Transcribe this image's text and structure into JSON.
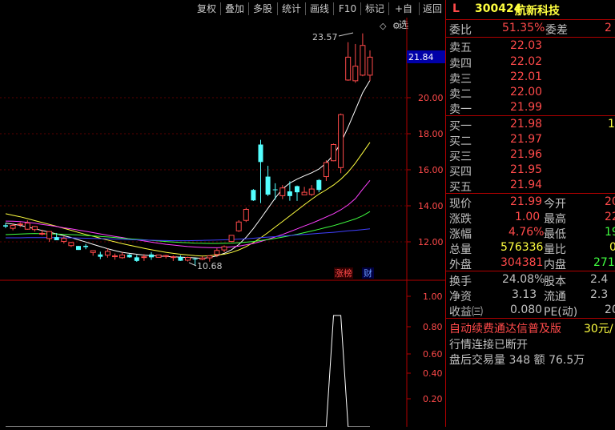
{
  "toolbar": {
    "buttons": [
      "复权",
      "叠加",
      "多股",
      "统计",
      "画线",
      "F10",
      "标记",
      "+自选",
      "返回"
    ]
  },
  "chart": {
    "price_ticks": [
      "20.00",
      "18.00",
      "16.00",
      "14.00",
      "12.00"
    ],
    "current_price_tag": "21.84",
    "high_annotation": "23.57",
    "low_annotation": "10.68",
    "badge_zhangbang": "涨榜",
    "badge_cai": "财",
    "indicator_ticks": [
      "1.00",
      "0.80",
      "0.60",
      "0.40",
      "0.20"
    ],
    "diamond_glyph": "◇"
  },
  "chart_data": {
    "type": "candlestick",
    "candles": [
      {
        "o": 12.92,
        "c": 12.85,
        "h": 13.05,
        "l": 12.76
      },
      {
        "o": 12.75,
        "c": 12.91,
        "h": 13.03,
        "l": 12.64
      },
      {
        "o": 12.99,
        "c": 12.99,
        "h": 13.08,
        "l": 12.82
      },
      {
        "o": 12.7,
        "c": 13.04,
        "h": 13.19,
        "l": 12.67
      },
      {
        "o": 12.68,
        "c": 12.85,
        "h": 12.88,
        "l": 12.57
      },
      {
        "o": 12.47,
        "c": 12.47,
        "h": 12.67,
        "l": 12.36
      },
      {
        "o": 12.18,
        "c": 12.57,
        "h": 12.58,
        "l": 12.0
      },
      {
        "o": 12.26,
        "c": 12.09,
        "h": 12.49,
        "l": 12.09
      },
      {
        "o": 12.02,
        "c": 12.19,
        "h": 12.3,
        "l": 11.91
      },
      {
        "o": 11.79,
        "c": 11.96,
        "h": 12.0,
        "l": 11.71
      },
      {
        "o": 11.77,
        "c": 11.55,
        "h": 11.78,
        "l": 11.55
      },
      {
        "o": 11.78,
        "c": 11.71,
        "h": 11.88,
        "l": 11.59
      },
      {
        "o": 11.41,
        "c": 11.51,
        "h": 11.52,
        "l": 11.23
      },
      {
        "o": 11.3,
        "c": 11.17,
        "h": 11.45,
        "l": 11.04
      },
      {
        "o": 11.26,
        "c": 11.47,
        "h": 11.63,
        "l": 11.12
      },
      {
        "o": 11.22,
        "c": 11.22,
        "h": 11.35,
        "l": 11.01
      },
      {
        "o": 11.12,
        "c": 11.27,
        "h": 11.42,
        "l": 11.06
      },
      {
        "o": 11.29,
        "c": 11.14,
        "h": 11.32,
        "l": 11.12
      },
      {
        "o": 11.14,
        "c": 10.94,
        "h": 11.27,
        "l": 10.89
      },
      {
        "o": 11.13,
        "c": 11.17,
        "h": 11.32,
        "l": 10.94
      },
      {
        "o": 11.3,
        "c": 11.14,
        "h": 11.43,
        "l": 11.0
      },
      {
        "o": 11.14,
        "c": 11.27,
        "h": 11.28,
        "l": 11.13
      },
      {
        "o": 11.19,
        "c": 11.24,
        "h": 11.28,
        "l": 11.08
      },
      {
        "o": 11.13,
        "c": 11.17,
        "h": 11.24,
        "l": 10.94
      },
      {
        "o": 11.15,
        "c": 10.95,
        "h": 11.25,
        "l": 10.94
      },
      {
        "o": 10.98,
        "c": 11.13,
        "h": 11.17,
        "l": 10.91
      },
      {
        "o": 11.07,
        "c": 11.03,
        "h": 11.09,
        "l": 10.68
      },
      {
        "o": 11.03,
        "c": 11.1,
        "h": 11.2,
        "l": 10.98
      },
      {
        "o": 11.11,
        "c": 11.22,
        "h": 11.22,
        "l": 10.9
      },
      {
        "o": 11.3,
        "c": 11.52,
        "h": 11.64,
        "l": 11.15
      },
      {
        "o": 11.55,
        "c": 11.73,
        "h": 11.8,
        "l": 11.42
      },
      {
        "o": 12.02,
        "c": 12.36,
        "h": 12.37,
        "l": 11.98
      },
      {
        "o": 12.61,
        "c": 13.1,
        "h": 13.2,
        "l": 12.55
      },
      {
        "o": 13.19,
        "c": 13.8,
        "h": 13.89,
        "l": 13.1
      },
      {
        "o": 14.88,
        "c": 14.3,
        "h": 14.93,
        "l": 14.27
      },
      {
        "o": 17.4,
        "c": 16.43,
        "h": 17.66,
        "l": 14.15
      },
      {
        "o": 15.62,
        "c": 14.62,
        "h": 16.22,
        "l": 14.54
      },
      {
        "o": 14.91,
        "c": 14.9,
        "h": 15.25,
        "l": 14.34
      },
      {
        "o": 14.56,
        "c": 14.99,
        "h": 15.15,
        "l": 14.37
      },
      {
        "o": 14.8,
        "c": 14.54,
        "h": 15.36,
        "l": 14.28
      },
      {
        "o": 15.09,
        "c": 14.75,
        "h": 15.12,
        "l": 14.27
      },
      {
        "o": 14.61,
        "c": 14.75,
        "h": 15.05,
        "l": 14.63
      },
      {
        "o": 14.63,
        "c": 14.93,
        "h": 15.15,
        "l": 14.55
      },
      {
        "o": 15.43,
        "c": 14.88,
        "h": 15.48,
        "l": 14.75
      },
      {
        "o": 15.62,
        "c": 16.4,
        "h": 16.53,
        "l": 15.38
      },
      {
        "o": 16.5,
        "c": 17.4,
        "h": 17.45,
        "l": 16.48
      },
      {
        "o": 16.12,
        "c": 19.06,
        "h": 19.12,
        "l": 15.81
      },
      {
        "o": 20.98,
        "c": 22.25,
        "h": 23.08,
        "l": 20.94
      },
      {
        "o": 20.94,
        "c": 21.75,
        "h": 22.98,
        "l": 20.83
      },
      {
        "o": 21.25,
        "c": 22.9,
        "h": 23.57,
        "l": 21.19
      },
      {
        "o": 21.25,
        "c": 22.25,
        "h": 22.63,
        "l": 20.94
      }
    ],
    "ma_lines": [
      {
        "color": "#ffffff",
        "values": [
          13.04,
          12.98,
          12.91,
          12.82,
          12.73,
          12.63,
          12.54,
          12.44,
          12.34,
          12.24,
          12.11,
          11.99,
          11.86,
          11.74,
          11.62,
          11.51,
          11.42,
          11.36,
          11.31,
          11.26,
          11.23,
          11.21,
          11.19,
          11.17,
          11.15,
          11.13,
          11.11,
          11.08,
          11.13,
          11.22,
          11.36,
          11.56,
          11.85,
          12.25,
          12.74,
          13.29,
          13.86,
          14.43,
          14.94,
          15.26,
          15.48,
          15.66,
          15.83,
          16.04,
          16.38,
          16.83,
          17.49,
          18.37,
          19.32,
          20.28,
          20.96
        ]
      },
      {
        "color": "#ffff40",
        "values": [
          13.56,
          13.47,
          13.39,
          13.29,
          13.18,
          13.07,
          12.97,
          12.86,
          12.75,
          12.64,
          12.52,
          12.41,
          12.31,
          12.2,
          12.1,
          12.0,
          11.9,
          11.81,
          11.73,
          11.64,
          11.56,
          11.49,
          11.42,
          11.36,
          11.31,
          11.27,
          11.23,
          11.21,
          11.23,
          11.27,
          11.31,
          11.41,
          11.55,
          11.73,
          11.96,
          12.22,
          12.51,
          12.82,
          13.13,
          13.44,
          13.75,
          14.06,
          14.36,
          14.65,
          14.89,
          15.15,
          15.47,
          15.87,
          16.37,
          16.94,
          17.52
        ]
      },
      {
        "color": "#ff40ff",
        "values": [
          13.15,
          13.14,
          13.12,
          13.08,
          13.03,
          12.97,
          12.91,
          12.85,
          12.78,
          12.72,
          12.65,
          12.58,
          12.51,
          12.44,
          12.37,
          12.3,
          12.24,
          12.17,
          12.11,
          12.05,
          11.98,
          11.92,
          11.86,
          11.82,
          11.78,
          11.74,
          11.71,
          11.69,
          11.68,
          11.67,
          11.69,
          11.72,
          11.76,
          11.83,
          11.91,
          12.02,
          12.14,
          12.27,
          12.41,
          12.56,
          12.72,
          12.88,
          13.03,
          13.2,
          13.38,
          13.56,
          13.78,
          14.05,
          14.4,
          14.92,
          15.41
        ]
      },
      {
        "color": "#40ff40",
        "values": [
          12.4,
          12.42,
          12.43,
          12.45,
          12.46,
          12.45,
          12.44,
          12.43,
          12.42,
          12.4,
          12.38,
          12.35,
          12.33,
          12.3,
          12.27,
          12.24,
          12.2,
          12.17,
          12.14,
          12.11,
          12.08,
          12.05,
          12.02,
          11.99,
          11.97,
          11.95,
          11.93,
          11.92,
          11.91,
          11.91,
          11.92,
          11.93,
          11.95,
          11.98,
          12.02,
          12.07,
          12.13,
          12.19,
          12.26,
          12.34,
          12.42,
          12.51,
          12.6,
          12.7,
          12.8,
          12.9,
          13.02,
          13.14,
          13.27,
          13.45,
          13.68
        ]
      },
      {
        "color": "#4040ff",
        "values": [
          12.22,
          12.22,
          12.22,
          12.23,
          12.23,
          12.23,
          12.23,
          12.23,
          12.22,
          12.22,
          12.21,
          12.2,
          12.19,
          12.18,
          12.17,
          12.15,
          12.14,
          12.12,
          12.11,
          12.1,
          12.09,
          12.08,
          12.07,
          12.06,
          12.06,
          12.06,
          12.07,
          12.08,
          12.09,
          12.1,
          12.11,
          12.13,
          12.15,
          12.17,
          12.2,
          12.23,
          12.26,
          12.29,
          12.32,
          12.35,
          12.38,
          12.41,
          12.44,
          12.47,
          12.5,
          12.53,
          12.57,
          12.61,
          12.64,
          12.68,
          12.72
        ]
      }
    ],
    "indicator": {
      "type": "line",
      "ylim": [
        0,
        1.1
      ],
      "values": [
        0,
        0,
        0,
        0,
        0,
        0,
        0,
        0,
        0,
        0,
        0,
        0,
        0,
        0,
        0,
        0,
        0,
        0,
        0,
        0,
        0,
        0,
        0,
        0,
        0,
        0,
        0,
        0,
        0,
        0,
        0,
        0,
        0,
        0,
        0,
        0,
        0,
        0,
        0,
        0,
        0,
        0,
        0,
        0,
        0,
        1,
        1,
        0,
        0,
        0,
        0
      ]
    },
    "ylim": [
      10.2,
      24.2
    ],
    "grid": true
  },
  "quote": {
    "header": {
      "market": "L",
      "code": "300424",
      "name": "航新科技"
    },
    "weibi": {
      "label": "委比",
      "value": "51.35%",
      "label2": "委差",
      "value2": "2"
    },
    "asks": [
      {
        "label": "卖五",
        "price": "22.03"
      },
      {
        "label": "卖四",
        "price": "22.02"
      },
      {
        "label": "卖三",
        "price": "22.01"
      },
      {
        "label": "卖二",
        "price": "22.00"
      },
      {
        "label": "卖一",
        "price": "21.99"
      }
    ],
    "bids": [
      {
        "label": "买一",
        "price": "21.98",
        "vol": "1"
      },
      {
        "label": "买二",
        "price": "21.97"
      },
      {
        "label": "买三",
        "price": "21.96"
      },
      {
        "label": "买四",
        "price": "21.95"
      },
      {
        "label": "买五",
        "price": "21.94"
      }
    ],
    "stats": [
      {
        "l1": "现价",
        "v1": "21.99",
        "l2": "今开",
        "v2": "20"
      },
      {
        "l1": "涨跌",
        "v1": "1.00",
        "l2": "最高",
        "v2": "22"
      },
      {
        "l1": "涨幅",
        "v1": "4.76%",
        "l2": "最低",
        "v2": "19"
      },
      {
        "l1": "总量",
        "v1": "576336",
        "l2": "量比",
        "v2": "0"
      },
      {
        "l1": "外盘",
        "v1": "304381",
        "l2": "内盘",
        "v2": "271"
      }
    ],
    "finance": [
      {
        "l1": "换手",
        "v1": "24.08%",
        "l2": "股本",
        "v2": "2.4"
      },
      {
        "l1": "净资",
        "v1": "3.13",
        "l2": "流通",
        "v2": "2.3"
      },
      {
        "l1": "收益㈢",
        "v1": "0.080",
        "l2": "PE(动)",
        "v2": "20"
      }
    ],
    "promo": {
      "text": "自动续费通达信普及版",
      "price": "30元/"
    },
    "status_line": "行情连接已断开",
    "after_hours": "盘后交易量 348 额 76.5万"
  }
}
